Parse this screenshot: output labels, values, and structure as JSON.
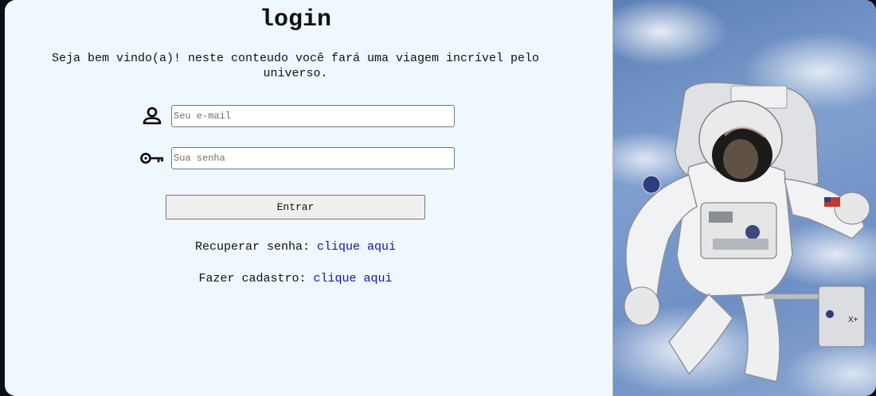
{
  "login": {
    "title": "login",
    "welcome": "Seja bem vindo(a)! neste conteudo você fará uma viagem incrível pelo universo.",
    "email_placeholder": "Seu e-mail",
    "password_placeholder": "Sua senha",
    "submit_label": "Entrar",
    "recover_label": "Recuperar senha:",
    "recover_link": "clique aqui",
    "signup_label": "Fazer cadastro:",
    "signup_link": "clique aqui"
  },
  "icons": {
    "email": "user-icon",
    "password": "key-icon"
  },
  "image": {
    "subject": "astronaut-photo"
  },
  "colors": {
    "panel_background": "#eff7ff",
    "link": "#1a12a8",
    "button": "#efefef"
  }
}
